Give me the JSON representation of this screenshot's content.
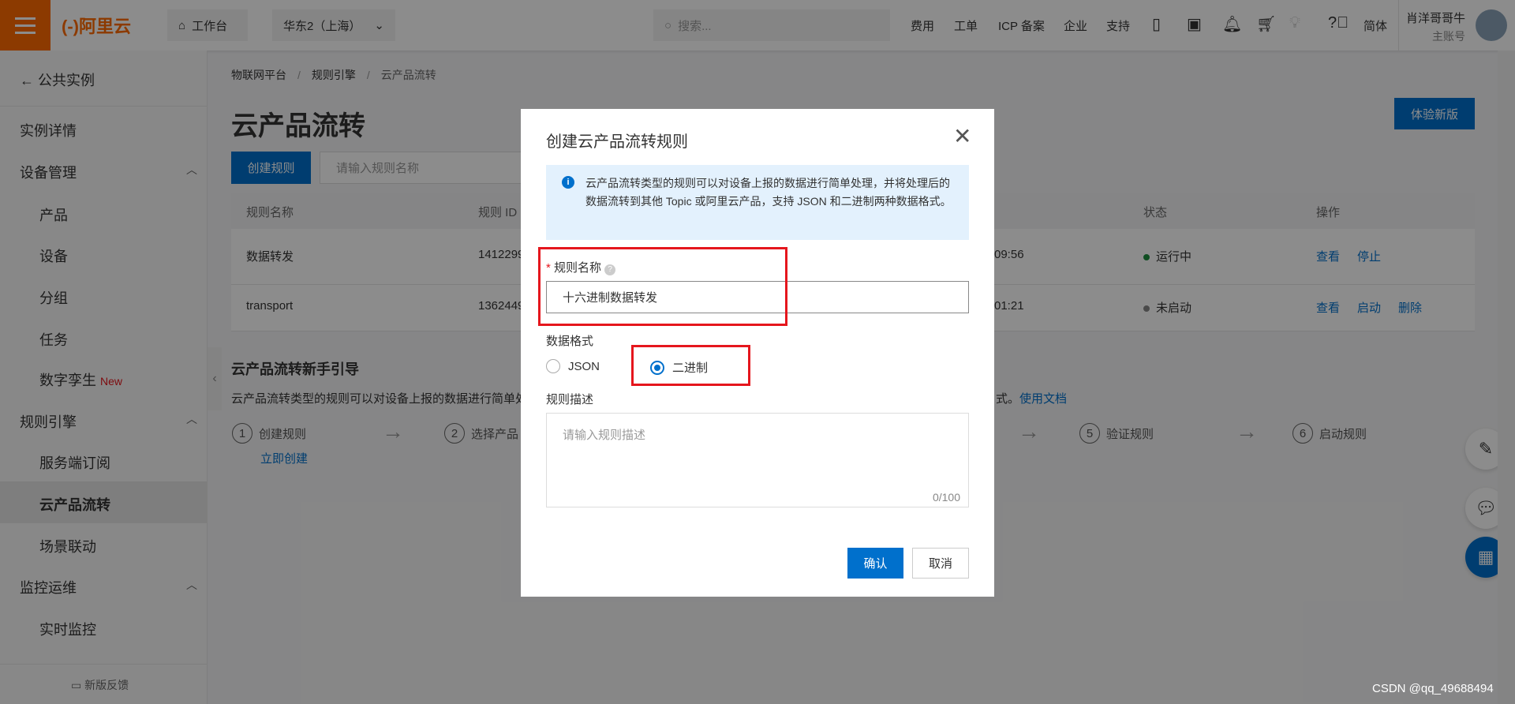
{
  "topbar": {
    "logo": "(-)阿里云",
    "workbench": "工作台",
    "region": "华东2（上海）",
    "search_placeholder": "搜索...",
    "links": [
      "费用",
      "工单",
      "ICP 备案",
      "企业",
      "支持"
    ],
    "lang": "简体",
    "user_name": "肖洋哥哥牛",
    "user_role": "主账号"
  },
  "sidebar": {
    "back": "公共实例",
    "items": [
      {
        "label": "实例详情"
      },
      {
        "label": "设备管理"
      },
      {
        "label": "产品"
      },
      {
        "label": "设备"
      },
      {
        "label": "分组"
      },
      {
        "label": "任务"
      },
      {
        "label": "数字孪生",
        "badge": "New"
      },
      {
        "label": "规则引擎"
      },
      {
        "label": "服务端订阅"
      },
      {
        "label": "云产品流转"
      },
      {
        "label": "场景联动"
      },
      {
        "label": "监控运维"
      },
      {
        "label": "实时监控"
      }
    ],
    "feedback": "新版反馈"
  },
  "main": {
    "breadcrumb": [
      "物联网平台",
      "规则引擎",
      "云产品流转"
    ],
    "title": "云产品流转",
    "try_new": "体验新版",
    "create_btn": "创建规则",
    "search_placeholder": "请输入规则名称",
    "columns": [
      "规则名称",
      "规则 ID",
      "状态",
      "操作"
    ],
    "rows": [
      {
        "name": "数据转发",
        "id": "1412299",
        "time": "09:56",
        "status": "运行中",
        "status_color": "#1e8e3e",
        "actions": [
          "查看",
          "停止"
        ]
      },
      {
        "name": "transport",
        "id": "1362449",
        "time": "01:21",
        "status": "未启动",
        "status_color": "#888888",
        "actions": [
          "查看",
          "启动",
          "删除"
        ]
      }
    ],
    "guide_title": "云产品流转新手引导",
    "guide_desc": "云产品流转类型的规则可以对设备上报的数据进行简单处",
    "guide_tail": "式。",
    "doc_link": "使用文档",
    "steps": [
      {
        "n": "1",
        "label": "创建规则"
      },
      {
        "n": "2",
        "label": "选择产品"
      },
      {
        "n": "5",
        "label": "验证规则"
      },
      {
        "n": "6",
        "label": "启动规则"
      }
    ],
    "create_now": "立即创建"
  },
  "modal": {
    "title": "创建云产品流转规则",
    "info": "云产品流转类型的规则可以对设备上报的数据进行简单处理，并将处理后的数据流转到其他 Topic 或阿里云产品，支持 JSON 和二进制两种数据格式。",
    "name_label": "规则名称",
    "name_value": "十六进制数据转发",
    "format_label": "数据格式",
    "format_options": [
      "JSON",
      "二进制"
    ],
    "format_selected": "二进制",
    "desc_label": "规则描述",
    "desc_placeholder": "请输入规则描述",
    "desc_count": "0/100",
    "confirm": "确认",
    "cancel": "取消"
  },
  "watermark": "CSDN @qq_49688494"
}
